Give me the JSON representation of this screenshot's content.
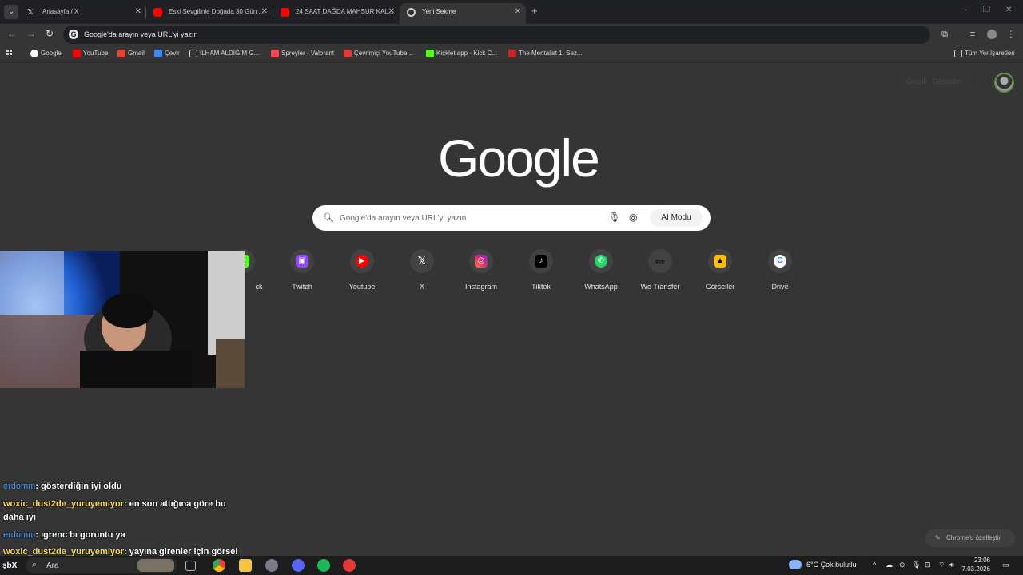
{
  "tabs": [
    {
      "title": "Anasayfa / X",
      "icon": "x-logo-icon",
      "active": false
    },
    {
      "title": "Eski Sevgilinle Doğada 30 Gün ...",
      "icon": "youtube-icon",
      "active": false
    },
    {
      "title": "24 SAAT DAĞDA MAHSUR KAL...",
      "icon": "youtube-icon",
      "active": false
    },
    {
      "title": "Yeni Sekme",
      "icon": "chrome-icon",
      "active": true
    }
  ],
  "omnibox": {
    "text": "Google'da arayın veya URL'yi yazın"
  },
  "bookmarks": [
    {
      "label": "Google",
      "color": "#ffffff"
    },
    {
      "label": "YouTube",
      "color": "#ff0000"
    },
    {
      "label": "Gmail",
      "color": "#ea4335"
    },
    {
      "label": "Çevir",
      "color": "#4285f4"
    },
    {
      "label": "İLHAM ALDIĞIM G...",
      "color": "#cfcfcf"
    },
    {
      "label": "Spreyler - Valorant",
      "color": "#ff4655"
    },
    {
      "label": "Çevrimiçi YouTube...",
      "color": "#e53935"
    },
    {
      "label": "Kicklet.app - Kick C...",
      "color": "#53fc18"
    },
    {
      "label": "The Mentalist 1. Sez...",
      "color": "#c62828"
    }
  ],
  "all_bookmarks": "Tüm Yer İşaretleri",
  "ntp": {
    "gmail_link": "Gmail",
    "images_link": "Görseller",
    "logo": "Google",
    "search_placeholder": "Google'da arayın veya URL'yi yazın",
    "ai_mode": "AI Modu",
    "customize": "Chrome'u özelleştir"
  },
  "shortcuts": [
    {
      "label": "ck",
      "icon": "kick-icon",
      "color": "#53fc18"
    },
    {
      "label": "Twitch",
      "icon": "twitch-icon",
      "color": "#9146ff"
    },
    {
      "label": "Youtube",
      "icon": "youtube-icon",
      "color": "#ff0000"
    },
    {
      "label": "X",
      "icon": "x-logo-icon",
      "color": "#424242"
    },
    {
      "label": "Instagram",
      "icon": "instagram-icon",
      "color": "#e1306c"
    },
    {
      "label": "Tiktok",
      "icon": "tiktok-icon",
      "color": "#000000"
    },
    {
      "label": "WhatsApp",
      "icon": "whatsapp-icon",
      "color": "#25d366"
    },
    {
      "label": "We Transfer",
      "icon": "wetransfer-icon",
      "color": "#424242"
    },
    {
      "label": "Görseller",
      "icon": "images-icon",
      "color": "#fbbc04"
    },
    {
      "label": "Drive",
      "icon": "google-icon",
      "color": "#ffffff"
    }
  ],
  "chat": [
    {
      "user": "erdomm",
      "user_color": "#4a9eff",
      "message": ": gösterdiğin iyi oldu"
    },
    {
      "user": "woxic_dust2de_yuruyemiyor",
      "user_color": "#f5d76e",
      "message": ": en son attığına göre bu daha iyi"
    },
    {
      "user": "erdomm",
      "user_color": "#4a9eff",
      "message": ": ıgrenc bı goruntu ya"
    },
    {
      "user": "woxic_dust2de_yuruyemiyor",
      "user_color": "#f5d76e",
      "message": ": yayına girenler için görsel"
    }
  ],
  "taskbar": {
    "search": "Ara",
    "weather": "6°C  Çok bulutlu",
    "time": "23:06",
    "date": "7.03.2026",
    "start_label": "şbX"
  }
}
